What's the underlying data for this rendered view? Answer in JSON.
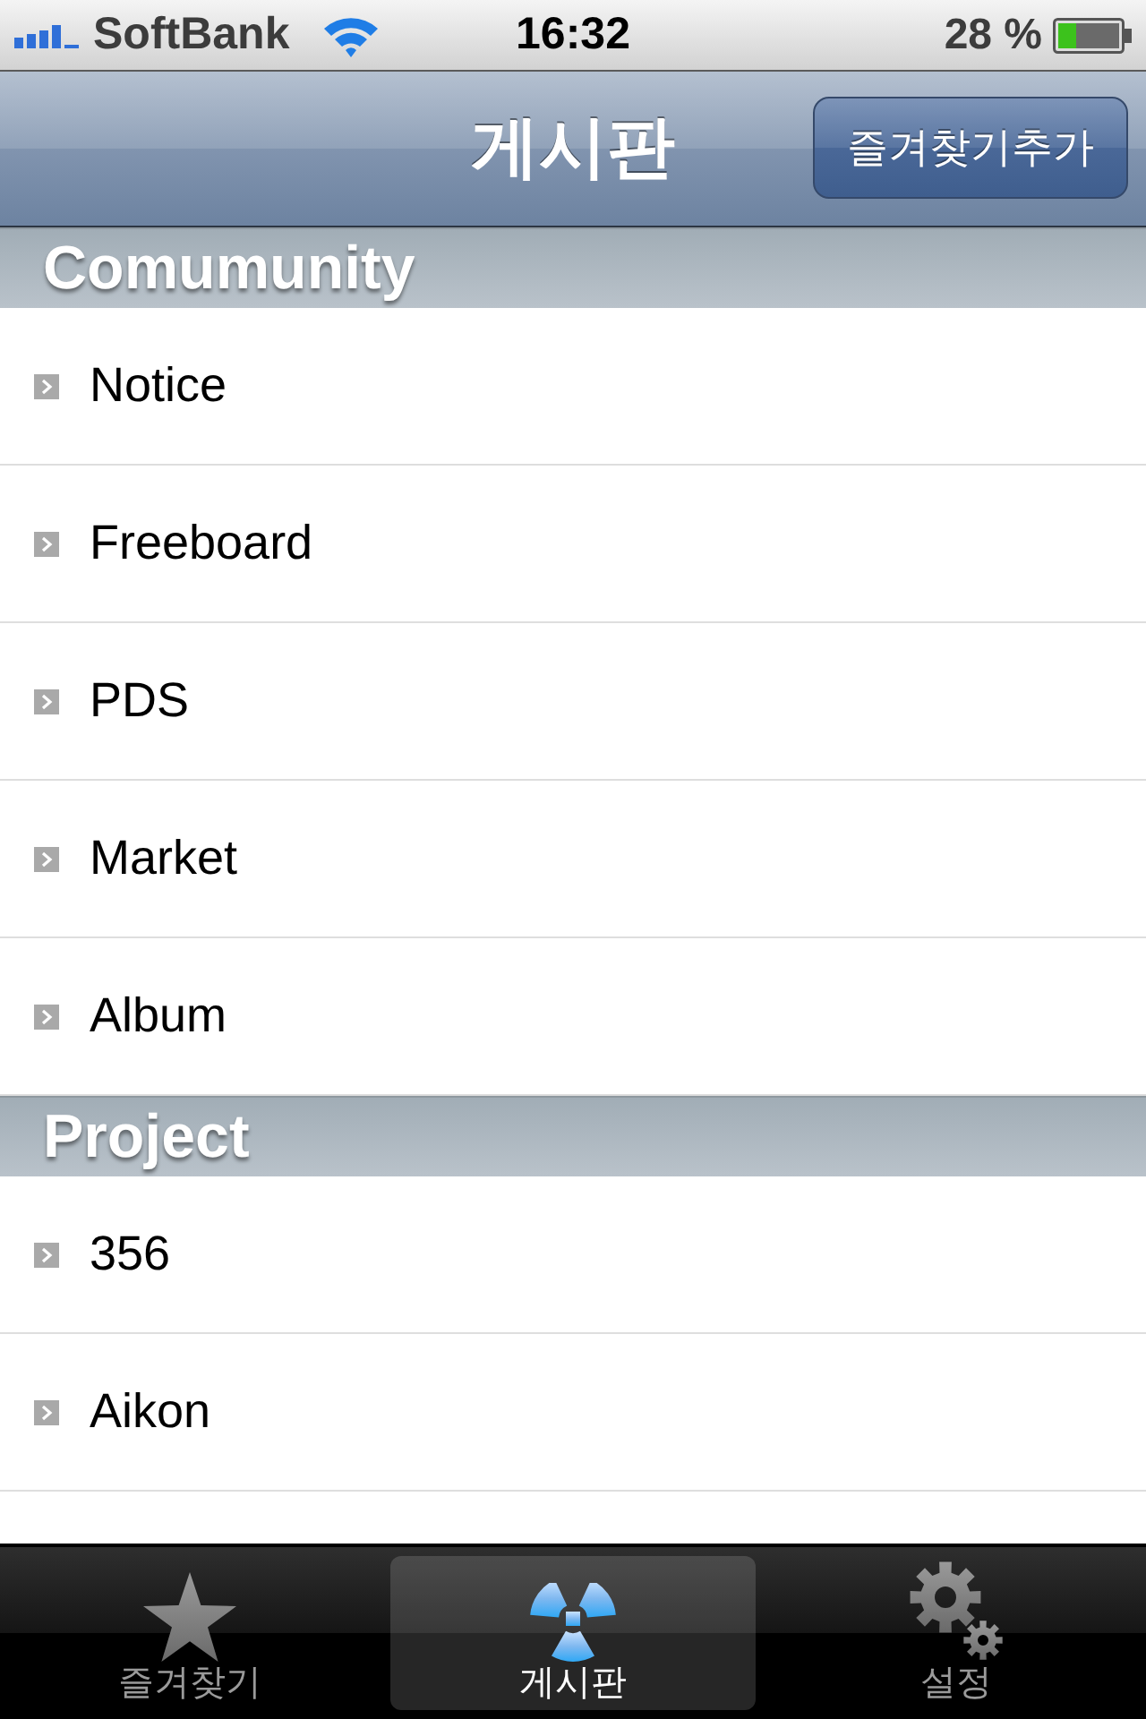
{
  "status_bar": {
    "carrier": "SoftBank",
    "time": "16:32",
    "battery": "28 %"
  },
  "nav_bar": {
    "title": "게시판",
    "button": "즐겨찾기추가"
  },
  "sections": [
    {
      "title": "Comumunity",
      "rows": [
        {
          "label": "Notice"
        },
        {
          "label": "Freeboard"
        },
        {
          "label": "PDS"
        },
        {
          "label": "Market"
        },
        {
          "label": "Album"
        }
      ]
    },
    {
      "title": "Project",
      "rows": [
        {
          "label": "356"
        },
        {
          "label": "Aikon"
        }
      ]
    }
  ],
  "tab_bar": {
    "tabs": [
      {
        "kind": "star",
        "label": "즐겨찾기",
        "selected": false
      },
      {
        "kind": "radiation",
        "label": "게시판",
        "selected": true
      },
      {
        "kind": "gears",
        "label": "설정",
        "selected": false
      }
    ]
  }
}
